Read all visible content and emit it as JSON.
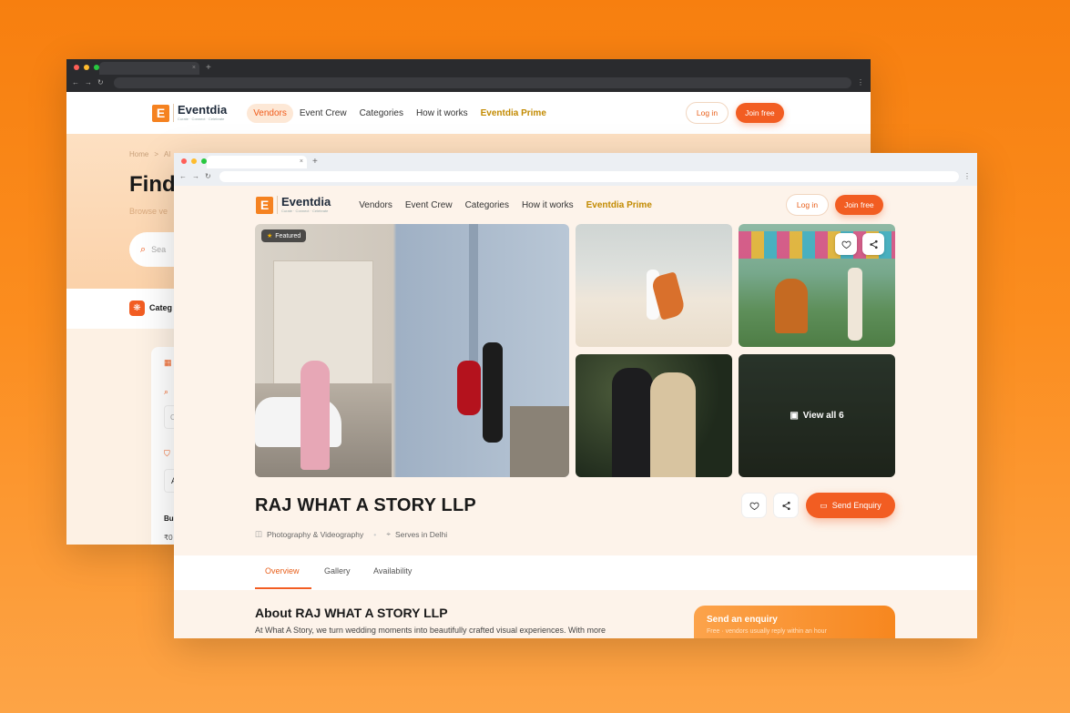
{
  "back_window": {
    "header": {
      "brand": "Eventdia",
      "tagline": "Curate · Connect · Celebrate",
      "nav": [
        "Vendors",
        "Event Crew",
        "Categories",
        "How it works",
        "Eventdia Prime"
      ],
      "login": "Log in",
      "join": "Join free"
    },
    "breadcrumb_home": "Home",
    "breadcrumb_sep": ">",
    "breadcrumb_next": "Al",
    "hero_title": "Find",
    "hero_sub": "Browse ve",
    "search_placeholder": "Sea",
    "categories_label": "Categ",
    "sidebar_heading": "Bu",
    "sidebar_value": "₹0",
    "field_a": "A",
    "field_c": "C"
  },
  "front_window": {
    "header": {
      "brand": "Eventdia",
      "tagline": "Curate · Connect · Celebrate",
      "nav": [
        "Vendors",
        "Event Crew",
        "Categories",
        "How it works",
        "Eventdia Prime"
      ],
      "login": "Log in",
      "join": "Join free"
    },
    "featured_badge": "Featured",
    "view_all": "View all 6",
    "vendor_name": "RAJ WHAT A STORY LLP",
    "category": "Photography & Videography",
    "serves": "Serves in Delhi",
    "send_enquiry": "Send Enquiry",
    "tabs": [
      "Overview",
      "Gallery",
      "Availability"
    ],
    "about_title": "About RAJ WHAT A STORY LLP",
    "about_text": "At What A Story, we turn wedding moments into beautifully crafted visual experiences. With more",
    "enquiry_card_title": "Send an enquiry",
    "enquiry_card_sub": "Free · vendors usually reply within an hour"
  },
  "colors": {
    "accent": "#f25d22",
    "prime": "#c28a00",
    "background": "#f77f0f"
  }
}
